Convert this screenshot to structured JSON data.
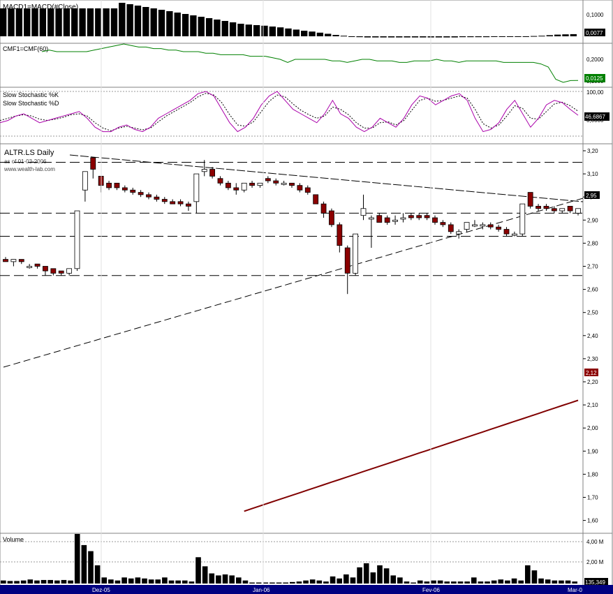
{
  "panes": {
    "macd": {
      "title": "MACD1=MACD(#Close)",
      "ticks": [
        "0,1000"
      ],
      "last_label": "0,0077",
      "values": [
        0.1,
        0.1,
        0.1,
        0.1,
        0.1,
        0.1,
        0.1,
        0.1,
        0.1,
        0.1,
        0.1,
        0.1,
        0.1,
        0.1,
        0.1,
        0.12,
        0.115,
        0.11,
        0.105,
        0.1,
        0.095,
        0.09,
        0.085,
        0.08,
        0.075,
        0.07,
        0.065,
        0.06,
        0.055,
        0.05,
        0.045,
        0.042,
        0.04,
        0.038,
        0.035,
        0.032,
        0.028,
        0.024,
        0.02,
        0.017,
        0.013,
        0.009,
        0.005,
        0.002,
        -0.001,
        -0.003,
        -0.004,
        -0.004,
        -0.004,
        -0.004,
        -0.004,
        -0.004,
        -0.004,
        -0.004,
        -0.004,
        -0.004,
        -0.004,
        -0.004,
        -0.003,
        -0.003,
        -0.003,
        -0.003,
        -0.002,
        -0.002,
        -0.001,
        -0.001,
        0.0,
        0.001,
        0.002,
        0.004,
        0.006,
        0.007,
        0.0077
      ]
    },
    "cmf": {
      "title": "CMF1=CMF(60)",
      "ticks": [
        "0,2000",
        "0,1000"
      ],
      "last_label": "0,0125",
      "values": [
        0.2,
        0.21,
        0.2,
        0.2,
        0.2,
        0.2,
        0.2,
        0.21,
        0.22,
        0.23,
        0.24,
        0.25,
        0.24,
        0.23,
        0.23,
        0.22,
        0.22,
        0.21,
        0.21,
        0.2,
        0.2,
        0.2,
        0.19,
        0.19,
        0.18,
        0.18,
        0.18,
        0.18,
        0.17,
        0.17,
        0.17,
        0.16,
        0.15,
        0.13,
        0.15,
        0.15,
        0.15,
        0.15,
        0.15,
        0.14,
        0.14,
        0.13,
        0.14,
        0.15,
        0.15,
        0.14,
        0.14,
        0.14,
        0.13,
        0.13,
        0.14,
        0.14,
        0.14,
        0.15,
        0.14,
        0.14,
        0.13,
        0.14,
        0.14,
        0.14,
        0.14,
        0.14,
        0.13,
        0.13,
        0.13,
        0.13,
        0.13,
        0.12,
        0.1,
        0.02,
        0.0,
        0.012,
        0.0125
      ]
    },
    "stoch": {
      "title_k": "Slow Stochastic %K",
      "title_d": "Slow Stochastic %D",
      "ticks": [
        "100,00",
        "0,0000"
      ],
      "last_label": "46,6867",
      "k": [
        30,
        35,
        45,
        50,
        40,
        30,
        35,
        40,
        45,
        50,
        55,
        40,
        20,
        10,
        10,
        20,
        25,
        15,
        10,
        20,
        40,
        50,
        60,
        70,
        80,
        95,
        100,
        90,
        60,
        30,
        10,
        20,
        40,
        70,
        90,
        100,
        80,
        60,
        50,
        40,
        30,
        50,
        80,
        50,
        40,
        20,
        10,
        20,
        40,
        30,
        20,
        40,
        70,
        90,
        85,
        70,
        80,
        90,
        95,
        80,
        40,
        10,
        15,
        30,
        60,
        80,
        50,
        20,
        40,
        70,
        80,
        75,
        60,
        46.7
      ],
      "d": [
        35,
        40,
        45,
        48,
        45,
        38,
        35,
        38,
        42,
        48,
        50,
        45,
        30,
        18,
        12,
        18,
        22,
        18,
        14,
        18,
        32,
        45,
        55,
        65,
        75,
        88,
        96,
        92,
        75,
        48,
        25,
        22,
        32,
        55,
        78,
        92,
        88,
        72,
        58,
        48,
        40,
        45,
        65,
        60,
        48,
        30,
        18,
        18,
        30,
        32,
        25,
        35,
        58,
        80,
        85,
        78,
        80,
        85,
        90,
        85,
        60,
        28,
        18,
        25,
        45,
        68,
        62,
        40,
        38,
        55,
        72,
        76,
        68,
        56
      ]
    },
    "price": {
      "title": "ALTR.LS Daily",
      "subtitle": "as of 01-03-2006",
      "source": "www.wealth-lab.com",
      "ticks": [
        "3,20",
        "3,10",
        "3,00",
        "2,90",
        "2,80",
        "2,70",
        "2,60",
        "2,50",
        "2,40",
        "2,30",
        "2,20",
        "2,10",
        "2,00",
        "1,90",
        "1,80",
        "1,70",
        "1,60"
      ],
      "tick_values": [
        3.2,
        3.1,
        3.0,
        2.9,
        2.8,
        2.7,
        2.6,
        2.5,
        2.4,
        2.3,
        2.2,
        2.1,
        2.0,
        1.9,
        1.8,
        1.7,
        1.6
      ],
      "close_label": "2,95",
      "ma_label": "2,12"
    },
    "volume": {
      "title": "Volume",
      "ticks": [
        "4,00 M",
        "2,00 M"
      ],
      "last_label": "135,349"
    }
  },
  "x_axis": {
    "labels": [
      "Dez-05",
      "Jan-06",
      "Fev-06",
      "Mar-0"
    ]
  },
  "colors": {
    "up": "#ffffff",
    "down": "#8b0000",
    "cmf_line": "#008000",
    "stoch_k": "#aa00aa",
    "ma_line": "#800000",
    "macd_bar": "#000000",
    "badge_green": "#008000",
    "badge_black": "#000000",
    "badge_red": "#8b0000",
    "axis_bar": "#000080"
  },
  "chart_data": {
    "type": "candlestick",
    "title": "ALTR.LS Daily",
    "x_axis_labels": [
      "Dez-05",
      "Jan-06",
      "Fev-06",
      "Mar-0"
    ],
    "ylim": [
      1.55,
      3.22
    ],
    "candles": [
      {
        "o": 2.73,
        "h": 2.74,
        "l": 2.72,
        "c": 2.72
      },
      {
        "o": 2.72,
        "h": 2.73,
        "l": 2.7,
        "c": 2.73
      },
      {
        "o": 2.73,
        "h": 2.73,
        "l": 2.71,
        "c": 2.72
      },
      {
        "o": 2.7,
        "h": 2.71,
        "l": 2.69,
        "c": 2.7
      },
      {
        "o": 2.71,
        "h": 2.71,
        "l": 2.69,
        "c": 2.7
      },
      {
        "o": 2.7,
        "h": 2.7,
        "l": 2.66,
        "c": 2.68
      },
      {
        "o": 2.69,
        "h": 2.69,
        "l": 2.66,
        "c": 2.67
      },
      {
        "o": 2.68,
        "h": 2.68,
        "l": 2.66,
        "c": 2.67
      },
      {
        "o": 2.67,
        "h": 2.69,
        "l": 2.66,
        "c": 2.69
      },
      {
        "o": 2.69,
        "h": 2.94,
        "l": 2.68,
        "c": 2.94
      },
      {
        "o": 3.03,
        "h": 3.11,
        "l": 2.98,
        "c": 3.11
      },
      {
        "o": 3.17,
        "h": 3.17,
        "l": 3.08,
        "c": 3.12
      },
      {
        "o": 3.09,
        "h": 3.09,
        "l": 3.02,
        "c": 3.05
      },
      {
        "o": 3.06,
        "h": 3.07,
        "l": 3.03,
        "c": 3.04
      },
      {
        "o": 3.06,
        "h": 3.06,
        "l": 3.03,
        "c": 3.04
      },
      {
        "o": 3.04,
        "h": 3.05,
        "l": 3.02,
        "c": 3.03
      },
      {
        "o": 3.03,
        "h": 3.04,
        "l": 3.01,
        "c": 3.02
      },
      {
        "o": 3.02,
        "h": 3.03,
        "l": 3.0,
        "c": 3.01
      },
      {
        "o": 3.01,
        "h": 3.02,
        "l": 2.99,
        "c": 3.0
      },
      {
        "o": 3.0,
        "h": 3.01,
        "l": 2.98,
        "c": 2.99
      },
      {
        "o": 2.99,
        "h": 3.0,
        "l": 2.97,
        "c": 2.98
      },
      {
        "o": 2.98,
        "h": 2.99,
        "l": 2.97,
        "c": 2.97
      },
      {
        "o": 2.98,
        "h": 2.99,
        "l": 2.96,
        "c": 2.97
      },
      {
        "o": 2.97,
        "h": 2.98,
        "l": 2.94,
        "c": 2.96
      },
      {
        "o": 2.98,
        "h": 3.1,
        "l": 2.93,
        "c": 3.1
      },
      {
        "o": 3.11,
        "h": 3.16,
        "l": 3.09,
        "c": 3.12
      },
      {
        "o": 3.12,
        "h": 3.13,
        "l": 3.08,
        "c": 3.09
      },
      {
        "o": 3.08,
        "h": 3.09,
        "l": 3.05,
        "c": 3.06
      },
      {
        "o": 3.06,
        "h": 3.07,
        "l": 3.03,
        "c": 3.04
      },
      {
        "o": 3.04,
        "h": 3.06,
        "l": 3.01,
        "c": 3.03
      },
      {
        "o": 3.03,
        "h": 3.06,
        "l": 3.02,
        "c": 3.06
      },
      {
        "o": 3.06,
        "h": 3.07,
        "l": 3.04,
        "c": 3.05
      },
      {
        "o": 3.05,
        "h": 3.06,
        "l": 3.04,
        "c": 3.06
      },
      {
        "o": 3.08,
        "h": 3.09,
        "l": 3.06,
        "c": 3.07
      },
      {
        "o": 3.07,
        "h": 3.08,
        "l": 3.05,
        "c": 3.06
      },
      {
        "o": 3.06,
        "h": 3.07,
        "l": 3.05,
        "c": 3.06
      },
      {
        "o": 3.06,
        "h": 3.06,
        "l": 3.04,
        "c": 3.05
      },
      {
        "o": 3.05,
        "h": 3.06,
        "l": 3.02,
        "c": 3.03
      },
      {
        "o": 3.04,
        "h": 3.05,
        "l": 3.01,
        "c": 3.02
      },
      {
        "o": 3.01,
        "h": 3.01,
        "l": 2.97,
        "c": 2.97
      },
      {
        "o": 2.97,
        "h": 2.98,
        "l": 2.91,
        "c": 2.93
      },
      {
        "o": 2.94,
        "h": 2.95,
        "l": 2.87,
        "c": 2.88
      },
      {
        "o": 2.88,
        "h": 2.89,
        "l": 2.76,
        "c": 2.79
      },
      {
        "o": 2.78,
        "h": 2.79,
        "l": 2.58,
        "c": 2.67
      },
      {
        "o": 2.67,
        "h": 2.84,
        "l": 2.66,
        "c": 2.84
      },
      {
        "o": 2.92,
        "h": 3.01,
        "l": 2.9,
        "c": 2.95
      },
      {
        "o": 2.91,
        "h": 2.92,
        "l": 2.78,
        "c": 2.91
      },
      {
        "o": 2.92,
        "h": 2.93,
        "l": 2.89,
        "c": 2.89
      },
      {
        "o": 2.91,
        "h": 2.92,
        "l": 2.88,
        "c": 2.89
      },
      {
        "o": 2.9,
        "h": 2.92,
        "l": 2.88,
        "c": 2.9
      },
      {
        "o": 2.91,
        "h": 2.93,
        "l": 2.89,
        "c": 2.91
      },
      {
        "o": 2.92,
        "h": 2.93,
        "l": 2.9,
        "c": 2.91
      },
      {
        "o": 2.92,
        "h": 2.93,
        "l": 2.9,
        "c": 2.91
      },
      {
        "o": 2.92,
        "h": 2.93,
        "l": 2.9,
        "c": 2.91
      },
      {
        "o": 2.91,
        "h": 2.92,
        "l": 2.88,
        "c": 2.89
      },
      {
        "o": 2.89,
        "h": 2.9,
        "l": 2.87,
        "c": 2.88
      },
      {
        "o": 2.88,
        "h": 2.89,
        "l": 2.84,
        "c": 2.85
      },
      {
        "o": 2.84,
        "h": 2.86,
        "l": 2.82,
        "c": 2.85
      },
      {
        "o": 2.86,
        "h": 2.89,
        "l": 2.85,
        "c": 2.89
      },
      {
        "o": 2.88,
        "h": 2.9,
        "l": 2.87,
        "c": 2.88
      },
      {
        "o": 2.88,
        "h": 2.89,
        "l": 2.86,
        "c": 2.88
      },
      {
        "o": 2.88,
        "h": 2.89,
        "l": 2.86,
        "c": 2.87
      },
      {
        "o": 2.87,
        "h": 2.88,
        "l": 2.85,
        "c": 2.86
      },
      {
        "o": 2.86,
        "h": 2.87,
        "l": 2.83,
        "c": 2.84
      },
      {
        "o": 2.84,
        "h": 2.85,
        "l": 2.83,
        "c": 2.84
      },
      {
        "o": 2.84,
        "h": 2.97,
        "l": 2.83,
        "c": 2.97
      },
      {
        "o": 3.02,
        "h": 3.02,
        "l": 2.95,
        "c": 2.96
      },
      {
        "o": 2.96,
        "h": 2.97,
        "l": 2.94,
        "c": 2.95
      },
      {
        "o": 2.96,
        "h": 2.97,
        "l": 2.94,
        "c": 2.95
      },
      {
        "o": 2.95,
        "h": 2.96,
        "l": 2.93,
        "c": 2.94
      },
      {
        "o": 2.94,
        "h": 2.95,
        "l": 2.93,
        "c": 2.95
      },
      {
        "o": 2.96,
        "h": 2.96,
        "l": 2.93,
        "c": 2.94
      },
      {
        "o": 2.93,
        "h": 2.95,
        "l": 2.92,
        "c": 2.95
      }
    ],
    "moving_average": {
      "start_index": 30,
      "start_value": 1.64,
      "end_value": 2.12
    },
    "volume_m": [
      0.3,
      0.25,
      0.25,
      0.3,
      0.4,
      0.3,
      0.35,
      0.35,
      0.3,
      0.35,
      0.3,
      4.9,
      3.8,
      3.2,
      1.8,
      0.6,
      0.4,
      0.3,
      0.6,
      0.5,
      0.6,
      0.5,
      0.4,
      0.4,
      0.6,
      0.3,
      0.3,
      0.3,
      0.2,
      2.6,
      1.7,
      1.0,
      0.8,
      0.9,
      0.8,
      0.6,
      0.3,
      0.1,
      0.1,
      0.1,
      0.1,
      0.1,
      0.1,
      0.15,
      0.2,
      0.3,
      0.4,
      0.3,
      0.2,
      0.7,
      0.5,
      0.9,
      0.6,
      1.6,
      2.0,
      1.1,
      1.8,
      1.5,
      0.8,
      0.6,
      0.2,
      0.1,
      0.3,
      0.2,
      0.3,
      0.3,
      0.2,
      0.2,
      0.2,
      0.2,
      0.6,
      0.2,
      0.2,
      0.3,
      0.4,
      0.3,
      0.5,
      0.3,
      1.8,
      1.3,
      0.5,
      0.4,
      0.3,
      0.3,
      0.3,
      0.2
    ],
    "support_resistance_levels": [
      3.15,
      2.93,
      2.83,
      2.66
    ]
  }
}
